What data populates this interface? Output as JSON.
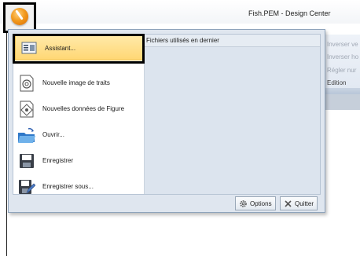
{
  "window": {
    "title": "Fish.PEM - Design Center"
  },
  "ribbon": {
    "items": [
      "Inverser ve",
      "Inverser ho",
      "Régler nur"
    ],
    "group_label": "Edition"
  },
  "app_menu": {
    "items": [
      {
        "label": "Assistant...",
        "icon": "wizard-icon",
        "highlighted": true
      },
      {
        "label": "Nouvelle image de traits",
        "icon": "new-line-image-icon"
      },
      {
        "label": "Nouvelles données de Figure",
        "icon": "new-figure-data-icon"
      },
      {
        "label": "Ouvrir...",
        "icon": "open-folder-icon"
      },
      {
        "label": "Enregistrer",
        "icon": "save-icon"
      },
      {
        "label": "Enregistrer sous...",
        "icon": "save-as-icon"
      }
    ],
    "recent_header": "Fichiers utilisés en dernier",
    "footer": {
      "options_label": "Options",
      "quit_label": "Quitter"
    }
  },
  "colors": {
    "highlight": "#ffd774",
    "menu_bg": "#dfe6ef",
    "orb": "#f29a1e"
  }
}
